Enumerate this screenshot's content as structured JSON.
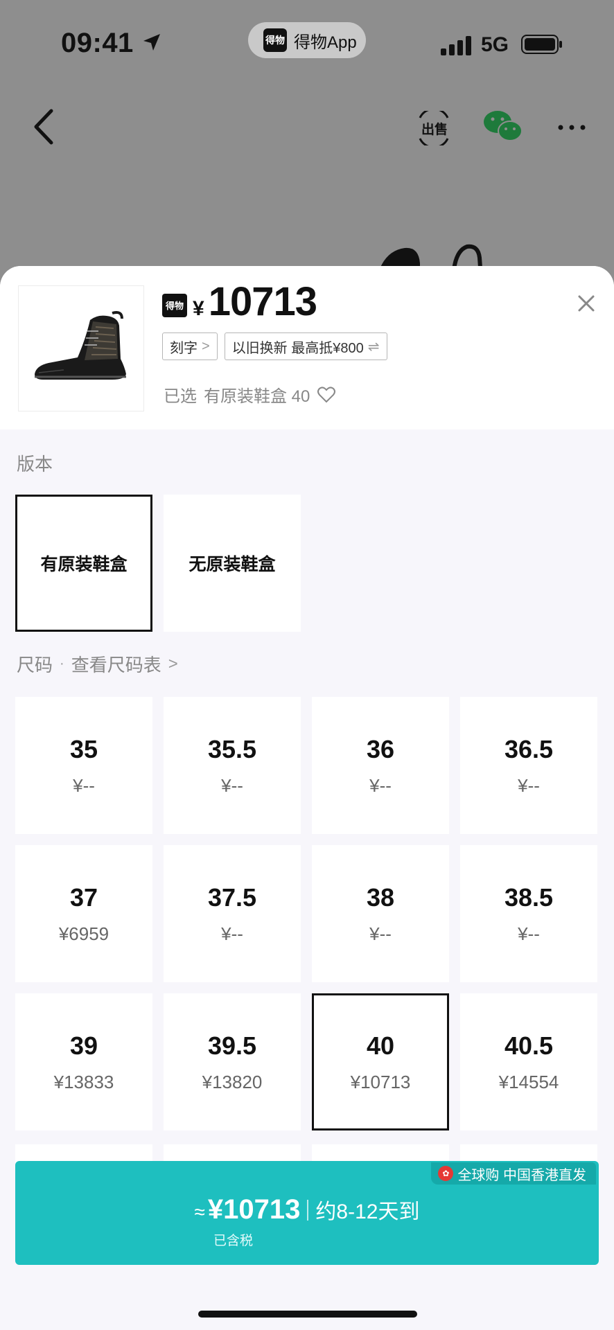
{
  "status_bar": {
    "time": "09:41",
    "app_name": "得物App",
    "app_logo_text": "得物",
    "network": "5G"
  },
  "nav": {
    "sell_label": "出售"
  },
  "product": {
    "logo_text": "得物",
    "currency": "¥",
    "price": "10713",
    "tags": [
      {
        "label": "刻字",
        "suffix": ">"
      },
      {
        "label": "以旧换新 最高抵¥800",
        "suffix": "⇌"
      }
    ],
    "selected_label": "已选",
    "selected_value": "有原装鞋盒 40"
  },
  "version": {
    "label": "版本",
    "options": [
      {
        "label": "有原装鞋盒",
        "selected": true
      },
      {
        "label": "无原装鞋盒",
        "selected": false
      }
    ]
  },
  "size": {
    "label": "尺码",
    "dot": "·",
    "chart_link": "查看尺码表",
    "chart_link_chevron": ">",
    "cells": [
      {
        "size": "35",
        "price": "¥--"
      },
      {
        "size": "35.5",
        "price": "¥--"
      },
      {
        "size": "36",
        "price": "¥--"
      },
      {
        "size": "36.5",
        "price": "¥--"
      },
      {
        "size": "37",
        "price": "¥6959"
      },
      {
        "size": "37.5",
        "price": "¥--"
      },
      {
        "size": "38",
        "price": "¥--"
      },
      {
        "size": "38.5",
        "price": "¥--"
      },
      {
        "size": "39",
        "price": "¥13833"
      },
      {
        "size": "39.5",
        "price": "¥13820"
      },
      {
        "size": "40",
        "price": "¥10713",
        "selected": true
      },
      {
        "size": "40.5",
        "price": "¥14554"
      }
    ]
  },
  "buy": {
    "badge": "全球购 中国香港直发",
    "approx": "≈",
    "price": "¥10713",
    "eta": "约8-12天到",
    "tax": "已含税"
  },
  "colors": {
    "accent": "#1ebfbf",
    "badge": "#15a9a9",
    "overlay": "#8e8e8e"
  }
}
